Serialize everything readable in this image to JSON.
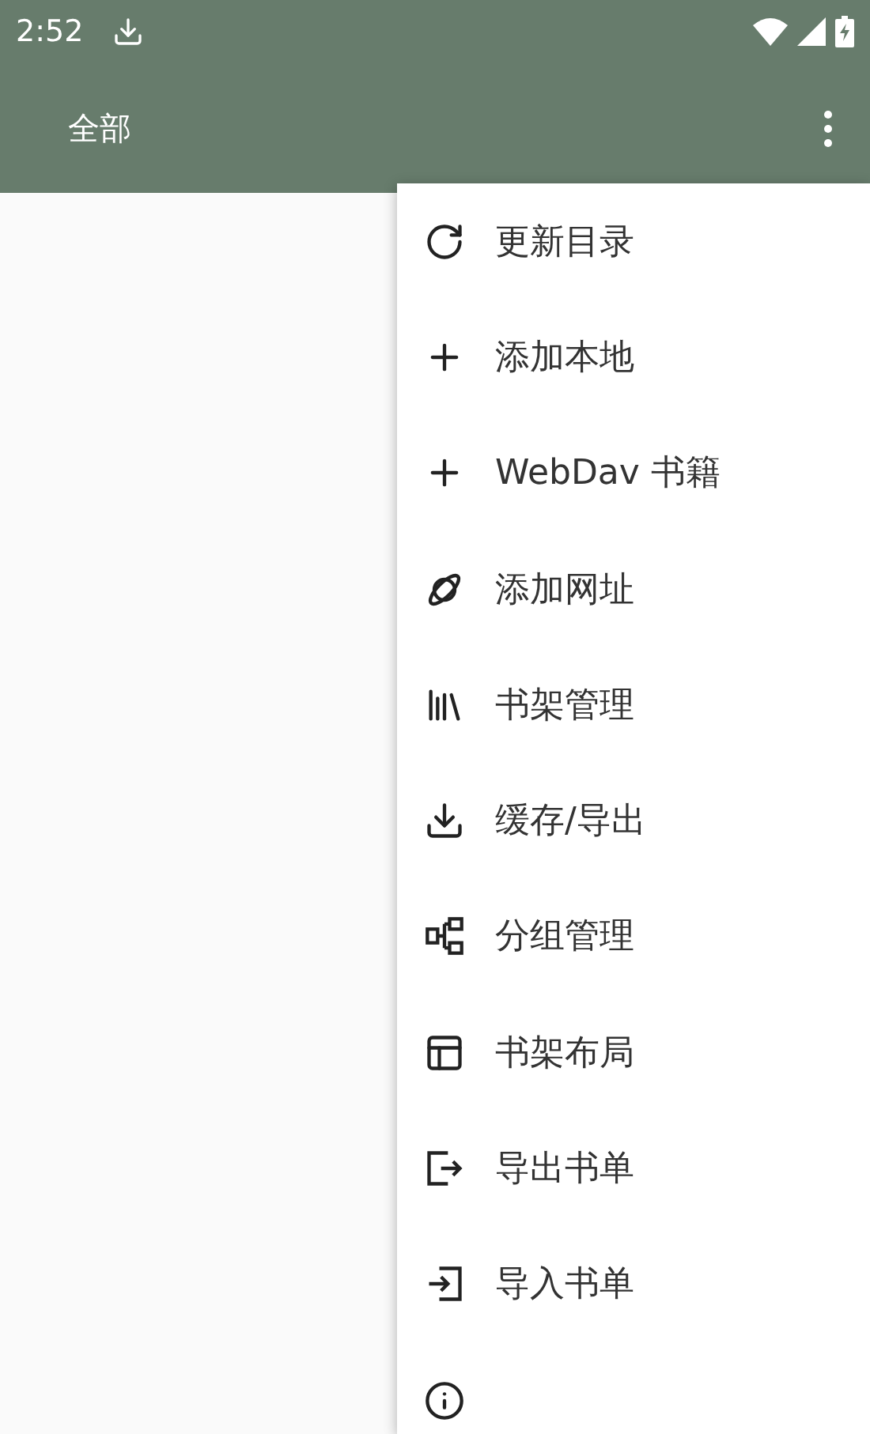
{
  "status_bar": {
    "time": "2:52"
  },
  "toolbar": {
    "title": "全部"
  },
  "menu": {
    "items": [
      {
        "kind": "refresh",
        "label": "更新目录"
      },
      {
        "kind": "add",
        "label": "添加本地"
      },
      {
        "kind": "add",
        "label": "WebDav 书籍"
      },
      {
        "kind": "planet",
        "label": "添加网址"
      },
      {
        "kind": "shelf",
        "label": "书架管理"
      },
      {
        "kind": "download",
        "label": "缓存/导出"
      },
      {
        "kind": "group",
        "label": "分组管理"
      },
      {
        "kind": "layout",
        "label": "书架布局"
      },
      {
        "kind": "export",
        "label": "导出书单"
      },
      {
        "kind": "import",
        "label": "导入书单"
      },
      {
        "kind": "info"
      }
    ]
  }
}
